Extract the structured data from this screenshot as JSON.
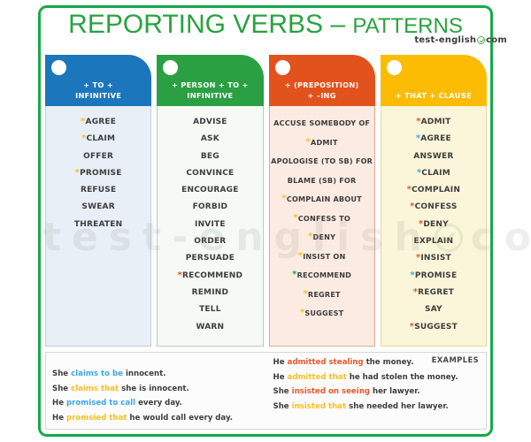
{
  "title": {
    "main": "REPORTING VERBS",
    "dash": " – ",
    "sub": "PATTERNS"
  },
  "logo": {
    "name": "test-english",
    "icon": "check-circle-icon",
    "tld": "com"
  },
  "watermark": {
    "text_left": "test-english",
    "icon": "check-circle-icon",
    "text_right": "com"
  },
  "colors": {
    "frame_green": "#17a84a",
    "title_green": "#29a33f",
    "col1_header": "#1b76bc",
    "col2_header": "#2aa043",
    "col3_header": "#e2521c",
    "col4_header": "#fcbc04",
    "col1_body": "#e9eff6",
    "col2_body": "#f5faf5",
    "col3_body": "#fcebe3",
    "col4_body": "#fbf6d9",
    "asterisk_yellow": "#f6bf26",
    "asterisk_orange": "#e8572a",
    "asterisk_blue": "#3ba9e8",
    "asterisk_green": "#2aa043",
    "highlight_blue": "#3ba9e8",
    "highlight_yellow": "#f6bf26",
    "highlight_red": "#e8572a"
  },
  "columns": [
    {
      "id": "to-infinitive",
      "header_line1": "+ TO +",
      "header_line2": "INFINITIVE",
      "header_color": "#1b76bc",
      "body_color": "#e9eff6",
      "border_color": "#b9cfdf",
      "words": [
        {
          "text": "AGREE",
          "asterisk": "yellow"
        },
        {
          "text": "CLAIM",
          "asterisk": "yellow"
        },
        {
          "text": "OFFER",
          "asterisk": null
        },
        {
          "text": "PROMISE",
          "asterisk": "yellow"
        },
        {
          "text": "REFUSE",
          "asterisk": null
        },
        {
          "text": "SWEAR",
          "asterisk": null
        },
        {
          "text": "THREATEN",
          "asterisk": null
        }
      ]
    },
    {
      "id": "person-to-infinitive",
      "header_line1": "+ PERSON + TO +",
      "header_line2": "INFINITIVE",
      "header_color": "#2aa043",
      "body_color": "#f5faf5",
      "border_color": "#aed3b3",
      "words": [
        {
          "text": "ADVISE",
          "asterisk": null
        },
        {
          "text": "ASK",
          "asterisk": null
        },
        {
          "text": "BEG",
          "asterisk": null
        },
        {
          "text": "CONVINCE",
          "asterisk": null
        },
        {
          "text": "ENCOURAGE",
          "asterisk": null
        },
        {
          "text": "FORBID",
          "asterisk": null
        },
        {
          "text": "INVITE",
          "asterisk": null
        },
        {
          "text": "ORDER",
          "asterisk": null
        },
        {
          "text": "PERSUADE",
          "asterisk": null
        },
        {
          "text": "RECOMMEND",
          "asterisk": "orange"
        },
        {
          "text": "REMIND",
          "asterisk": null
        },
        {
          "text": "TELL",
          "asterisk": null
        },
        {
          "text": "WARN",
          "asterisk": null
        }
      ]
    },
    {
      "id": "preposition-ing",
      "header_line1": "+ (PREPOSITION)",
      "header_line2": "+ –ING",
      "header_color": "#e2521c",
      "body_color": "#fcebe3",
      "border_color": "#e0a98f",
      "words": [
        {
          "text": "ACCUSE SOMEBODY OF",
          "asterisk": null
        },
        {
          "text": "ADMIT",
          "asterisk": "yellow"
        },
        {
          "text": "APOLOGISE (TO SB) FOR",
          "asterisk": null
        },
        {
          "text": "BLAME (SB) FOR",
          "asterisk": null
        },
        {
          "text": "COMPLAIN ABOUT",
          "asterisk": "yellow"
        },
        {
          "text": "CONFESS TO",
          "asterisk": "yellow"
        },
        {
          "text": "DENY",
          "asterisk": "yellow"
        },
        {
          "text": "INSIST ON",
          "asterisk": "yellow"
        },
        {
          "text": "RECOMMEND",
          "asterisk": "green"
        },
        {
          "text": "REGRET",
          "asterisk": "yellow"
        },
        {
          "text": "SUGGEST",
          "asterisk": "yellow"
        }
      ]
    },
    {
      "id": "that-clause",
      "header_line1": "+ THAT + CLAUSE",
      "header_line2": "",
      "header_color": "#fcbc04",
      "body_color": "#fbf6d9",
      "border_color": "#e3d9a0",
      "words": [
        {
          "text": "ADMIT",
          "asterisk": "orange"
        },
        {
          "text": "AGREE",
          "asterisk": "blue"
        },
        {
          "text": "ANSWER",
          "asterisk": null
        },
        {
          "text": "CLAIM",
          "asterisk": "blue"
        },
        {
          "text": "COMPLAIN",
          "asterisk": "orange"
        },
        {
          "text": "CONFESS",
          "asterisk": "orange"
        },
        {
          "text": "DENY",
          "asterisk": "orange"
        },
        {
          "text": "EXPLAIN",
          "asterisk": null
        },
        {
          "text": "INSIST",
          "asterisk": "orange"
        },
        {
          "text": "PROMISE",
          "asterisk": "blue"
        },
        {
          "text": "REGRET",
          "asterisk": "orange"
        },
        {
          "text": "SAY",
          "asterisk": null
        },
        {
          "text": "SUGGEST",
          "asterisk": "orange"
        }
      ]
    }
  ],
  "examples": {
    "label": "EXAMPLES",
    "left": [
      [
        {
          "t": "She ",
          "c": "plain"
        },
        {
          "t": "claims to be",
          "c": "blue"
        },
        {
          "t": " innocent.",
          "c": "plain"
        }
      ],
      [
        {
          "t": "She ",
          "c": "plain"
        },
        {
          "t": "claims that",
          "c": "yellow"
        },
        {
          "t": " she is innocent.",
          "c": "plain"
        }
      ],
      [
        {
          "t": "He ",
          "c": "plain"
        },
        {
          "t": "promised to call",
          "c": "blue"
        },
        {
          "t": " every day.",
          "c": "plain"
        }
      ],
      [
        {
          "t": "He ",
          "c": "plain"
        },
        {
          "t": "promsied that",
          "c": "yellow"
        },
        {
          "t": " he would call every day.",
          "c": "plain"
        }
      ]
    ],
    "right": [
      [
        {
          "t": "He ",
          "c": "plain"
        },
        {
          "t": "admitted stealing",
          "c": "red"
        },
        {
          "t": " the money.",
          "c": "plain"
        }
      ],
      [
        {
          "t": "He ",
          "c": "plain"
        },
        {
          "t": "admitted that",
          "c": "yellow"
        },
        {
          "t": " he had stolen the money.",
          "c": "plain"
        }
      ],
      [
        {
          "t": "She ",
          "c": "plain"
        },
        {
          "t": "insisted on seeing",
          "c": "red"
        },
        {
          "t": " her lawyer.",
          "c": "plain"
        }
      ],
      [
        {
          "t": "She ",
          "c": "plain"
        },
        {
          "t": "insisted that",
          "c": "yellow"
        },
        {
          "t": " she needed her lawyer.",
          "c": "plain"
        }
      ]
    ]
  }
}
